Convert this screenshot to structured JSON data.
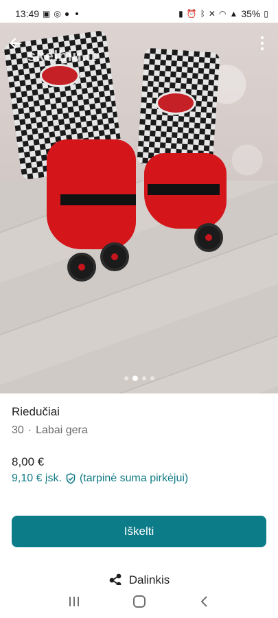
{
  "status_bar": {
    "time": "13:49",
    "battery": "35%",
    "left_icons": [
      "gallery-icon",
      "at-icon",
      "facebook-icon"
    ],
    "right_icons": [
      "battery-saver-icon",
      "alarm-icon",
      "bluetooth-icon",
      "mute-icon",
      "wifi-icon",
      "signal-icon"
    ]
  },
  "photo": {
    "watermark": "skelbiu.lt",
    "carousel": {
      "count": 4,
      "active_index": 1
    }
  },
  "listing": {
    "title": "Riedučiai",
    "size": "30",
    "separator": "·",
    "condition": "Labai gera",
    "price": "8,00 €",
    "buyer_price": "9,10 € įsk.",
    "buyer_note": "(tarpinė suma pirkėjui)"
  },
  "actions": {
    "primary_label": "Iškelti",
    "share_label": "Dalinkis"
  },
  "colors": {
    "accent": "#0c7c88",
    "buyer_price_text": "#127b86"
  }
}
